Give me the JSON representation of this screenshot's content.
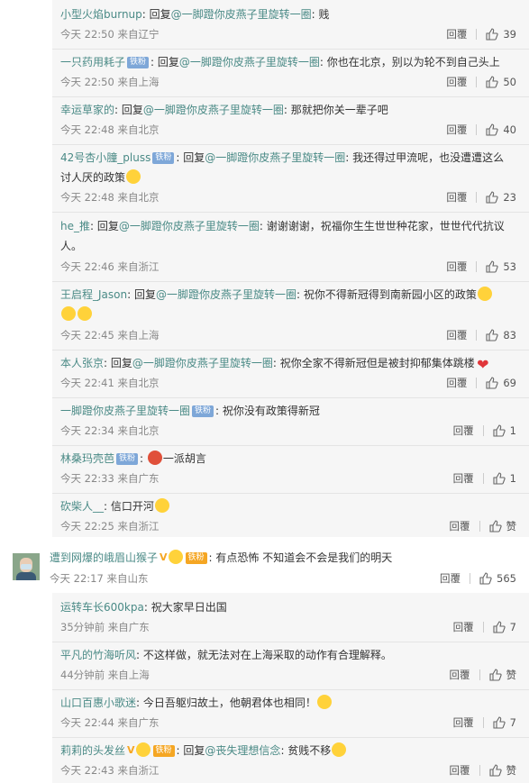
{
  "reply_word": "回复",
  "reply_prefix": "回复",
  "at_sign": "@",
  "colon": ": ",
  "reply_button": "回覆",
  "badge_iron_fan": "铁粉",
  "replies_a": [
    {
      "user": "小型火焰burnup",
      "target": "一脚蹬你皮燕子里旋转一圈",
      "text": "贱",
      "time": "今天 22:50",
      "loc": "来自辽宁",
      "likes": "39"
    },
    {
      "user": "一只药用耗子",
      "target": "一脚蹬你皮燕子里旋转一圈",
      "text": "你也在北京，别以为轮不到自己头上",
      "time": "今天 22:50",
      "loc": "来自上海",
      "likes": "50"
    },
    {
      "user": "幸运草家的",
      "target": "一脚蹬你皮燕子里旋转一圈",
      "text": "那就把你关一辈子吧",
      "time": "今天 22:48",
      "loc": "来自北京",
      "likes": "40"
    },
    {
      "user": "42号杏小膧_pluss",
      "target": "一脚蹬你皮燕子里旋转一圈",
      "text": "我还得过甲流呢，也没遭遭这么",
      "text2": "讨人厌的政策",
      "time": "今天 22:48",
      "loc": "来自北京",
      "likes": "23"
    },
    {
      "user": "he_推",
      "target": "一脚蹬你皮燕子里旋转一圈",
      "text": "谢谢谢谢，祝福你生生世世种花家，世世代代抗议",
      "text2": "人。",
      "time": "今天 22:46",
      "loc": "来自浙江",
      "likes": "53"
    },
    {
      "user": "王启程_Jason",
      "target": "一脚蹬你皮燕子里旋转一圈",
      "text": "祝你不得新冠得到南新园小区的政策",
      "time": "今天 22:45",
      "loc": "来自上海",
      "likes": "83"
    },
    {
      "user": "本人张京",
      "target": "一脚蹬你皮燕子里旋转一圈",
      "text": "祝你全家不得新冠但是被封抑郁集体跳楼",
      "time": "今天 22:41",
      "loc": "来自北京",
      "likes": "69"
    },
    {
      "user": "一脚蹬你皮燕子里旋转一圈",
      "text": "祝你没有政策得新冠",
      "time": "今天 22:34",
      "loc": "来自北京",
      "likes": "1"
    },
    {
      "user": "林桑玛壳芭",
      "text": "一派胡言",
      "time": "今天 22:33",
      "loc": "来自广东",
      "likes": "1"
    },
    {
      "user": "砍柴人__",
      "text": "信口开河",
      "time": "今天 22:25",
      "loc": "来自浙江",
      "likes": "赞"
    }
  ],
  "top_comment": {
    "user": "遭到网爆的峨眉山猴子",
    "v_mark": "V",
    "badge": "铁粉",
    "text": "有点恐怖 不知道会不会是我们的明天",
    "time": "今天 22:17",
    "loc": "来自山东",
    "likes": "565"
  },
  "replies_b": [
    {
      "user": "运转车长600kpa",
      "text": "祝大家早日出国",
      "time": "35分钟前",
      "loc": "来自广东",
      "likes": "7"
    },
    {
      "user": "平凡的竹海听风",
      "text": "不这样做，就无法对在上海采取的动作有合理解释。",
      "time": "44分钟前",
      "loc": "来自上海",
      "likes": "赞"
    },
    {
      "user": "山口百惠小歌迷",
      "text": "今日吾躯归故土，他朝君体也相同！",
      "time": "今天 22:44",
      "loc": "来自广东",
      "likes": "7"
    },
    {
      "user": "莉莉的头发丝",
      "v_mark": "V",
      "badge": "铁粉",
      "target": "丧失理想信念",
      "text": "贫贱不移",
      "time": "今天 22:43",
      "loc": "来自浙江",
      "likes": "赞"
    }
  ],
  "colors": {
    "name": "#4a8a86",
    "panel": "#f6f6f6",
    "badge": "#7ea7d8",
    "v_badge": "#f5a623"
  }
}
